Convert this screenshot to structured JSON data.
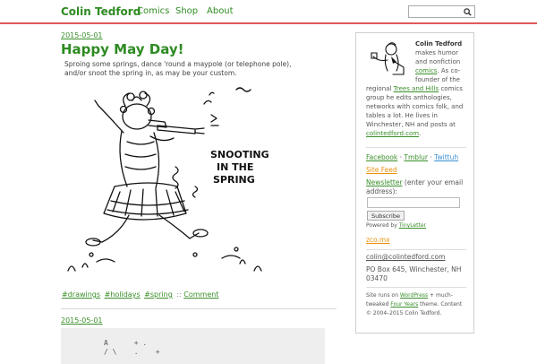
{
  "header": {
    "brand": "Colin Tedford",
    "nav": [
      "Comics",
      "Shop",
      "About"
    ],
    "search_placeholder": ""
  },
  "post1": {
    "date": "2015-05-01",
    "title": "Happy May Day!",
    "excerpt": "Sproing some springs, dance 'round a maypole (or telephone pole), and/or snoot the spring in, as may be your custom.",
    "comic_caption": [
      "SNOOTING",
      "IN THE",
      "SPRING"
    ],
    "tags": [
      "#drawings",
      "#holidays",
      "#spring"
    ],
    "tag_separator": "::",
    "comment_link": "Comment"
  },
  "post2": {
    "date": "2015-05-01",
    "preview_lines": [
      "A      + .",
      "/ \\    .    +"
    ]
  },
  "sidebar": {
    "bio_name": "Colin Tedford",
    "bio_1": "makes humor",
    "bio_2": "and nonfiction",
    "bio_3_link": "comics",
    "bio_3_tail": ". As co-",
    "bio_4": "founder of the",
    "bio_5a": "regional ",
    "bio_5_link": "Trees and Hills",
    "bio_5b": " comics",
    "bio_6": "group he edits anthologies,",
    "bio_7": "networks with comics folk, and",
    "bio_8": "tables a lot. He lives in",
    "bio_9": "Winchester, NH and posts at",
    "bio_10_link": "colintedford.com",
    "bio_10_tail": ".",
    "social": [
      "Facebook",
      "Tmblur",
      "Twittuh"
    ],
    "social_sep": "·",
    "site_feed": "Site Feed",
    "newsletter_link": "Newsletter",
    "newsletter_text_1": " (enter your email",
    "newsletter_text_2": "address):",
    "subscribe_label": "Subscribe",
    "powered_prefix": "Powered by ",
    "powered_link": "TinyLetter",
    "zco": "zco.mx",
    "email": "colin@colintedford.com",
    "address_1": "PO Box 645, Winchester, NH",
    "address_2": "03470",
    "footer_1a": "Site runs on ",
    "footer_1_link": "WordPress",
    "footer_1b": " + much-",
    "footer_2a": "tweaked ",
    "footer_2_link": "Four Years",
    "footer_2b": " theme. Content",
    "footer_3": "© 2004–2015 Colin Tedford."
  },
  "colors": {
    "accent": "#2e8b22",
    "rule": "#e05a5a",
    "feed": "#e8910c"
  },
  "icons": {
    "search": "search-icon",
    "avatar": "cartoon-self-portrait"
  }
}
